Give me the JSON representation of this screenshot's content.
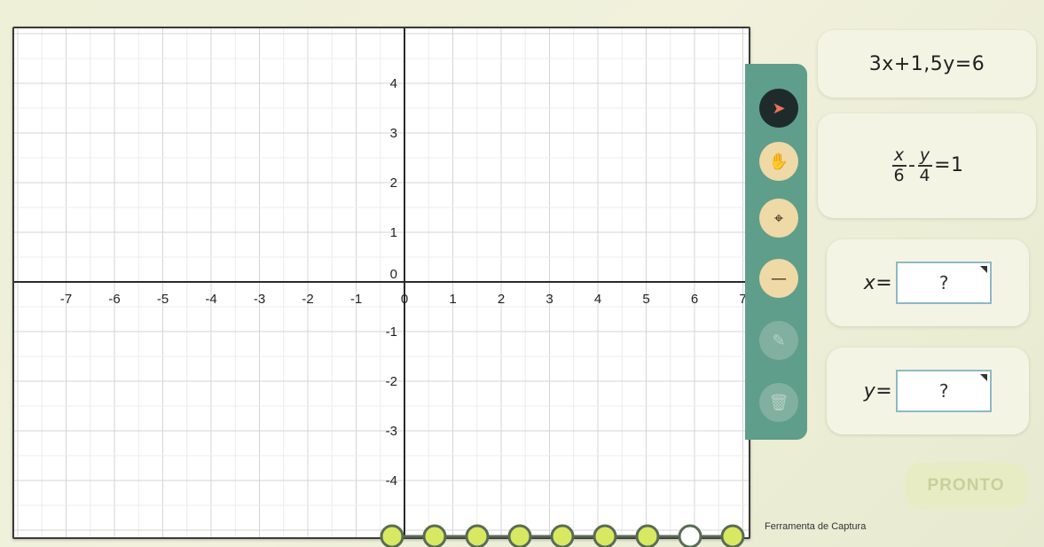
{
  "graph": {
    "x_min": -7,
    "x_max": 7,
    "y_min": -4,
    "y_max": 4,
    "x_ticks": [
      "-7",
      "-6",
      "-5",
      "-4",
      "-3",
      "-2",
      "-1",
      "0",
      "1",
      "2",
      "3",
      "4",
      "5",
      "6",
      "7"
    ],
    "y_ticks": [
      "4",
      "3",
      "2",
      "1",
      "0",
      "-1",
      "-2",
      "-3",
      "-4"
    ],
    "grid": true
  },
  "toolbar": {
    "tools": [
      {
        "name": "pointer-tool",
        "icon": "cursor-icon",
        "state": "active"
      },
      {
        "name": "pan-tool",
        "icon": "hand-icon",
        "state": "enabled"
      },
      {
        "name": "point-tool",
        "icon": "crosshair-point-icon",
        "state": "enabled"
      },
      {
        "name": "line-tool",
        "icon": "line-icon",
        "state": "enabled"
      },
      {
        "name": "eraser-tool",
        "icon": "eraser-icon",
        "state": "disabled"
      },
      {
        "name": "trash-tool",
        "icon": "trash-icon",
        "state": "disabled"
      }
    ]
  },
  "equations": {
    "eq1": {
      "text": "3x+1,5y=6"
    },
    "eq2": {
      "num_x": "x",
      "den_x": "6",
      "minus": "-",
      "num_y": "y",
      "den_y": "4",
      "rhs": "=1"
    }
  },
  "answers": {
    "x": {
      "label": "x=",
      "value": "?"
    },
    "y": {
      "label": "y=",
      "value": "?"
    }
  },
  "done_label": "PRONTO",
  "tooltip": "Ferramenta de Captura",
  "progress": {
    "states": [
      "done",
      "done",
      "done",
      "done",
      "done",
      "done",
      "done",
      "current",
      "pending"
    ],
    "colors": {
      "done": "#d8e860",
      "current": "#ffffff",
      "pending": "#d8e860",
      "line": "#5a6b55"
    }
  }
}
